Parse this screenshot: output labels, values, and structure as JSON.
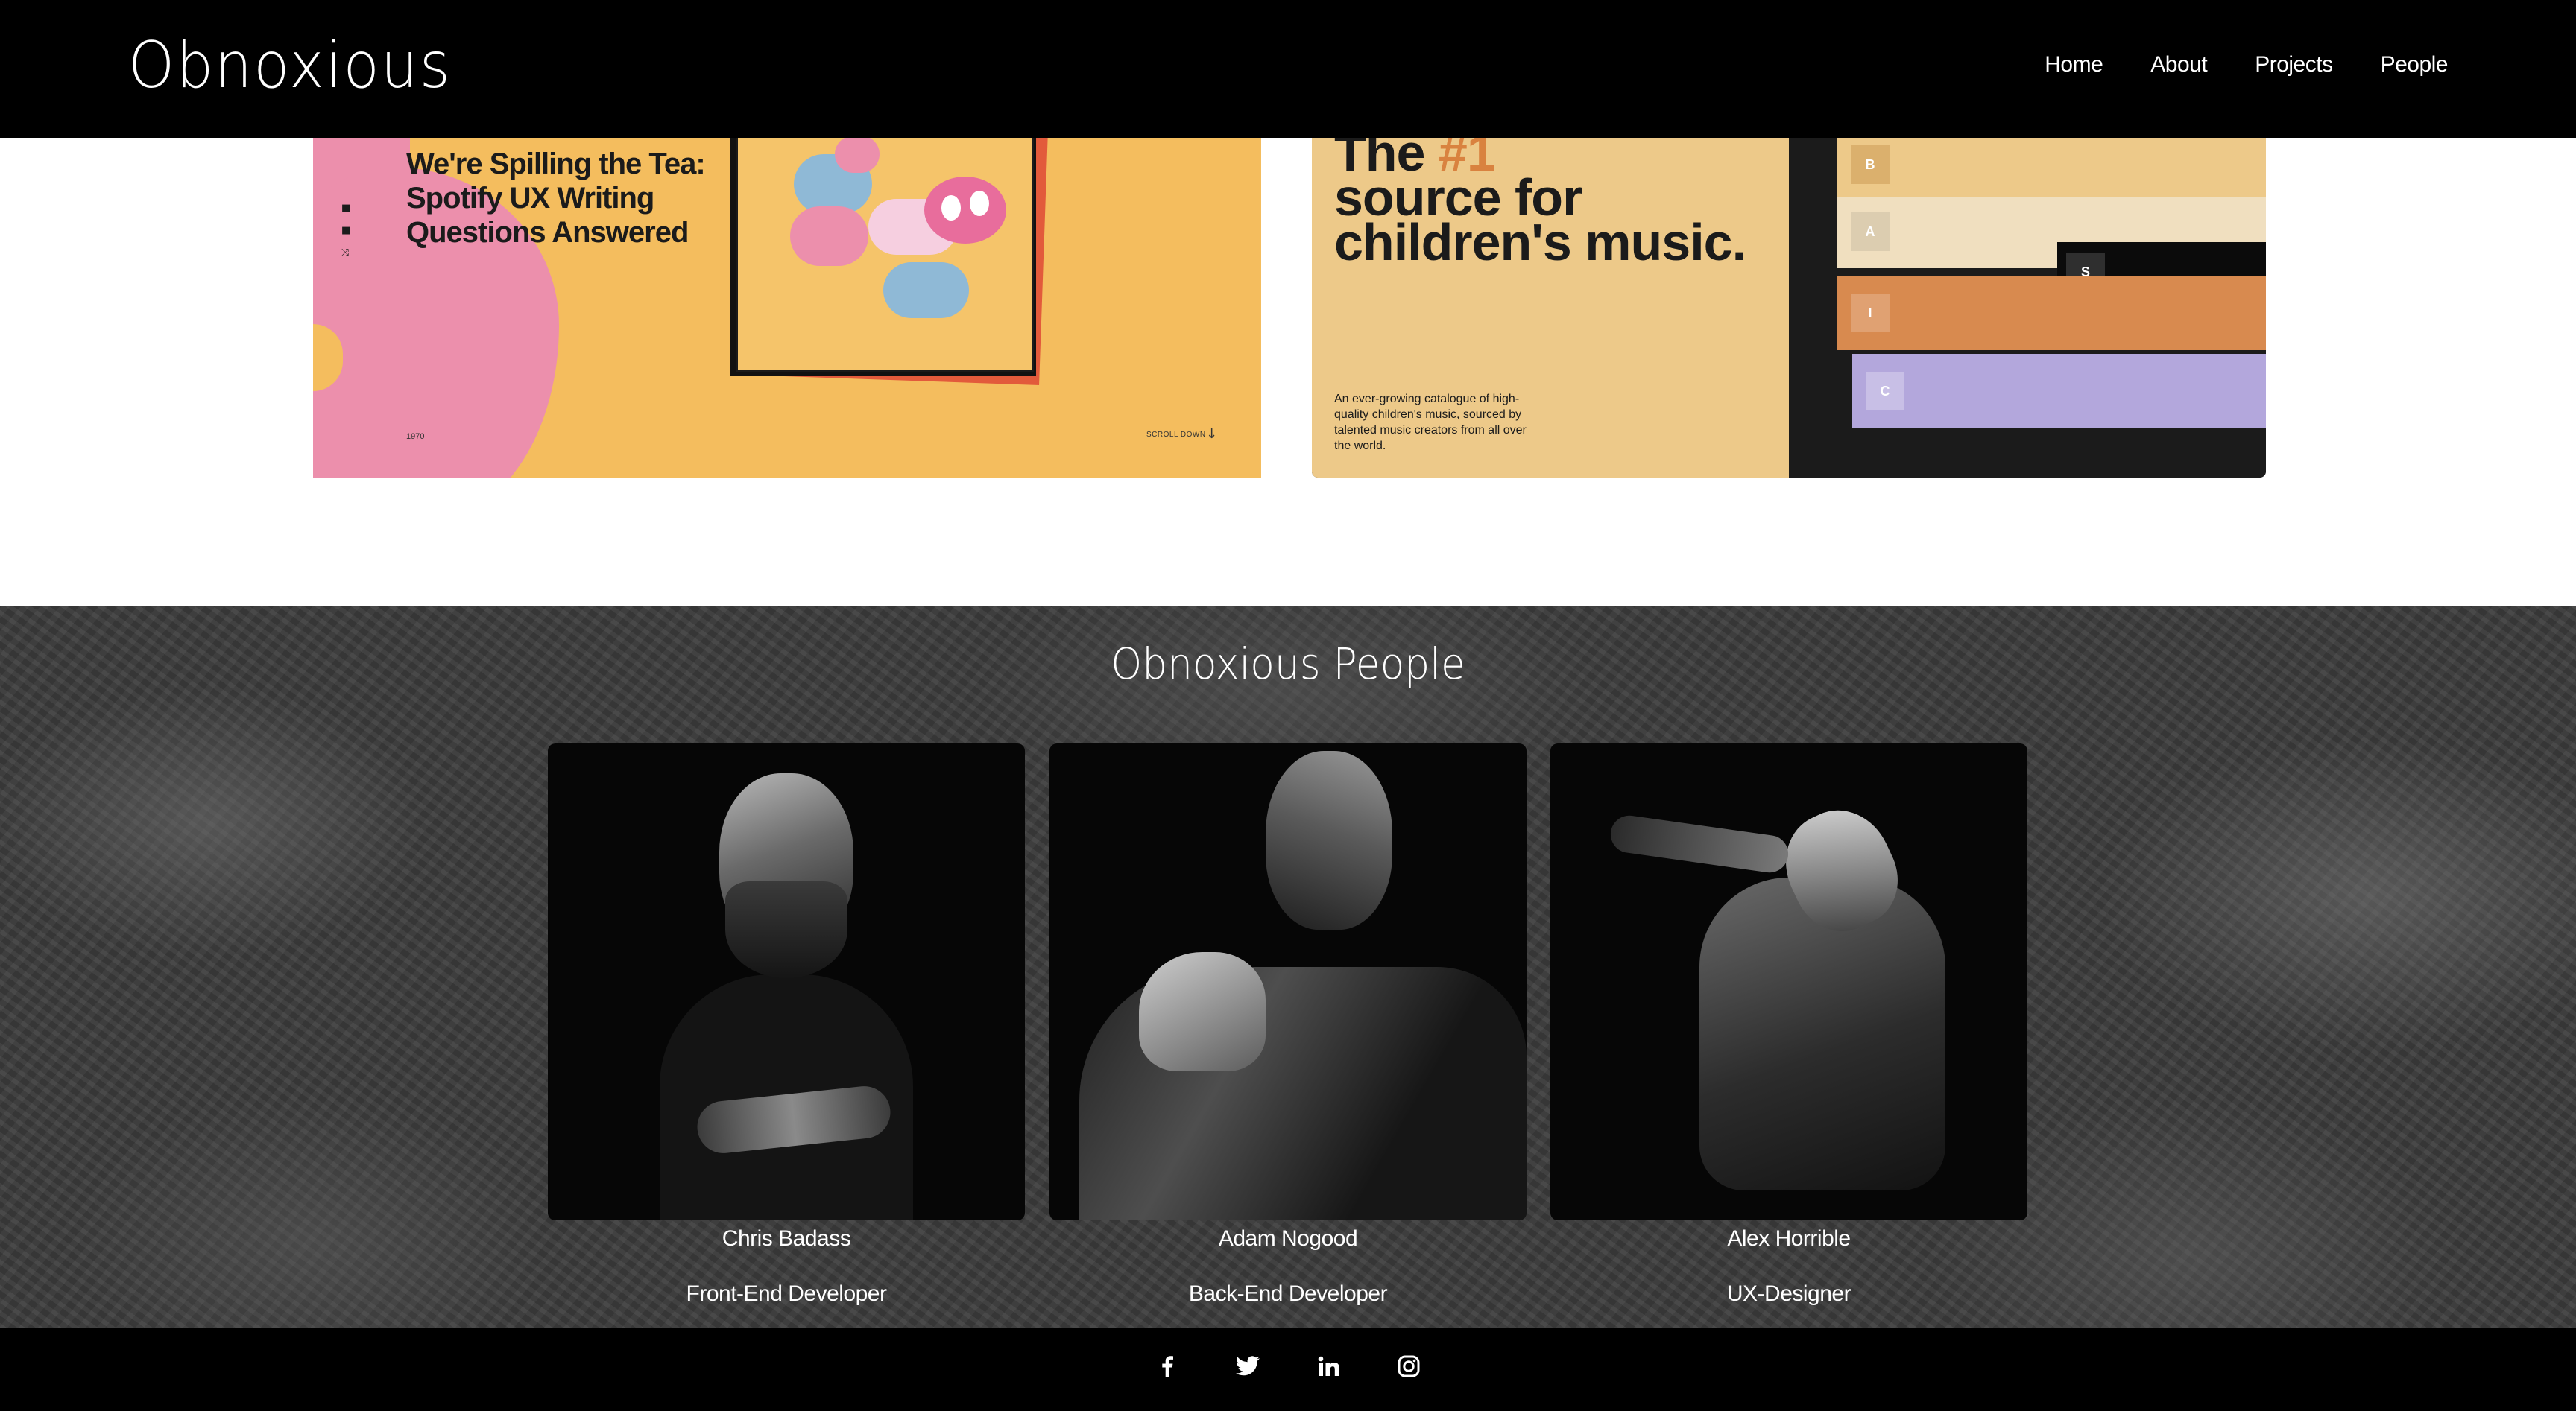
{
  "header": {
    "logo": "Obnoxious",
    "nav": [
      "Home",
      "About",
      "Projects",
      "People"
    ]
  },
  "projects": {
    "spotify": {
      "title": "We're Spilling the Tea: Spotify UX Writing Questions Answered",
      "year": "1970",
      "scroll": "SCROLL DOWN"
    },
    "music": {
      "headline_prefix": "The ",
      "headline_highlight": "#1",
      "headline_rest": "source for children's music.",
      "description": "An ever-growing catalogue of high-quality children's music, sourced by talented music creators from all over the world.",
      "bars": [
        "B",
        "A",
        "S",
        "I",
        "C"
      ]
    }
  },
  "people": {
    "title": "Obnoxious People",
    "members": [
      {
        "name": "Chris Badass",
        "role": "Front-End Developer"
      },
      {
        "name": "Adam Nogood",
        "role": "Back-End Developer"
      },
      {
        "name": "Alex Horrible",
        "role": "UX-Designer"
      }
    ]
  },
  "footer": {
    "socials": [
      "facebook-icon",
      "twitter-icon",
      "linkedin-icon",
      "instagram-icon"
    ]
  },
  "colors": {
    "header_bg": "#000000",
    "spotify_bg": "#f4bd5e",
    "spotify_pink": "#ec8fac",
    "music_bg": "#edc989",
    "music_accent": "#d9823f",
    "bar_orange": "#d88a4f",
    "bar_purple": "#b3a7dc"
  }
}
